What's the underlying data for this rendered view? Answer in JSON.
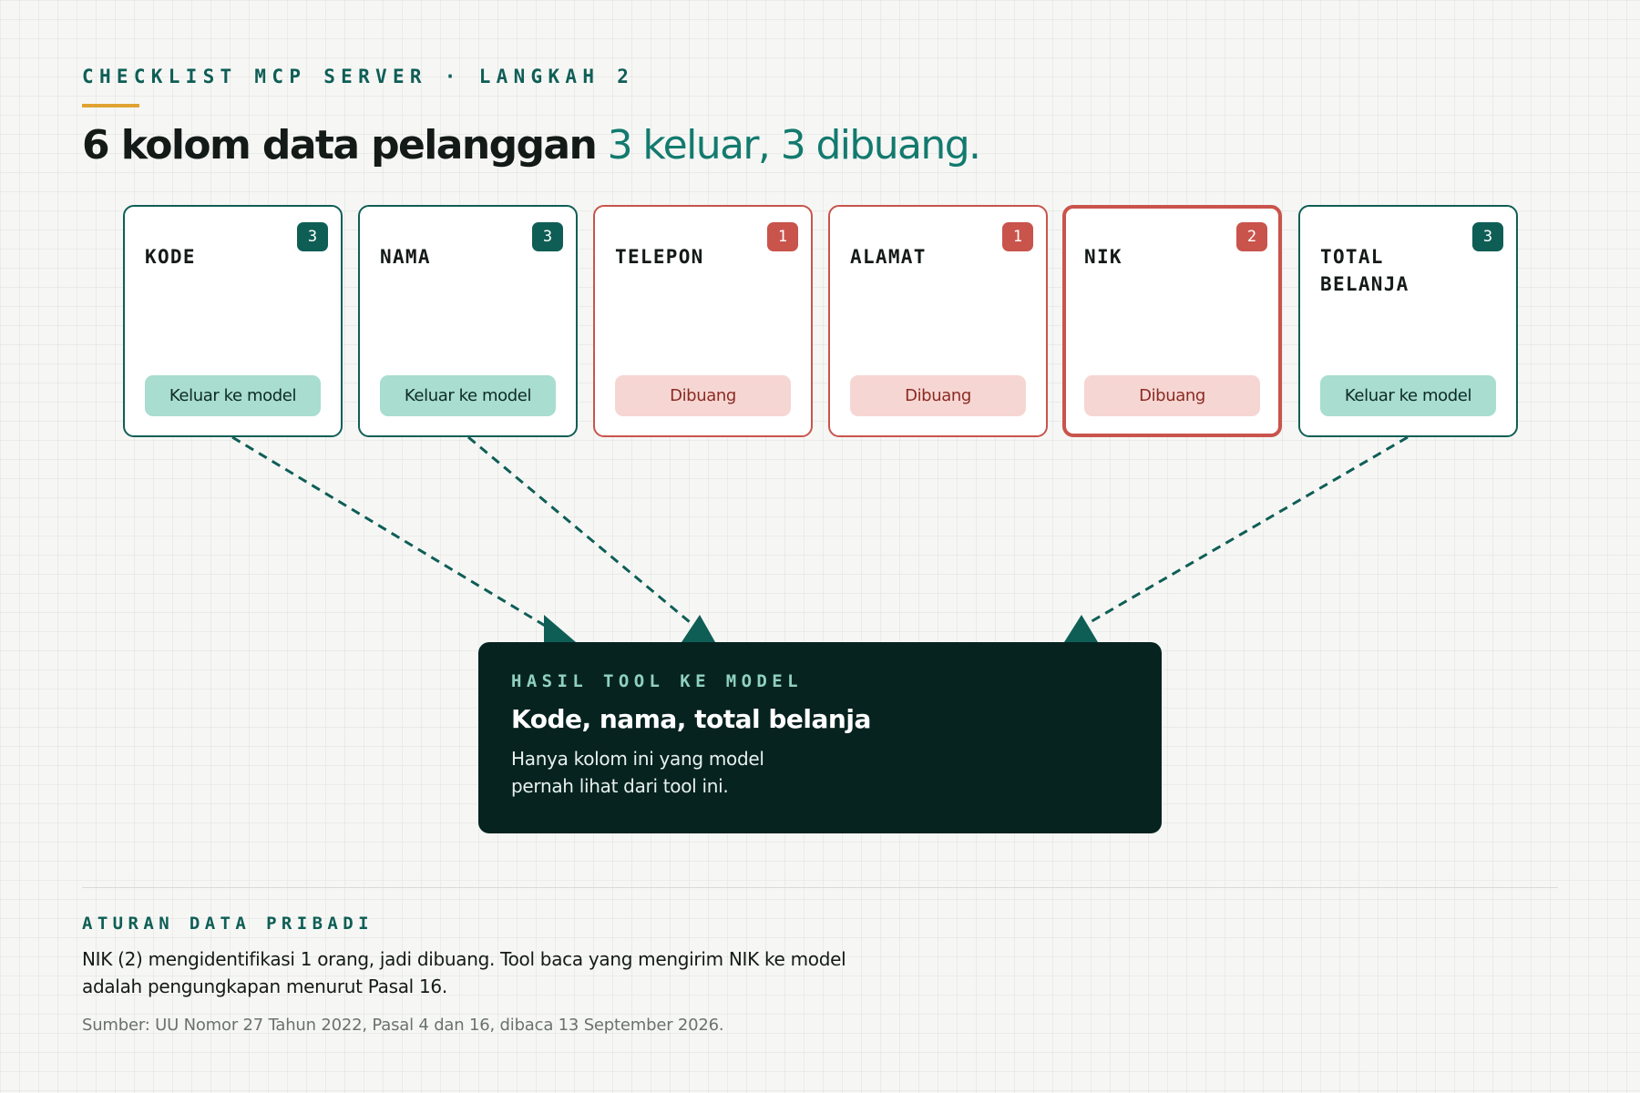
{
  "header": {
    "eyebrow": "CHECKLIST MCP SERVER · LANGKAH 2",
    "title_strong": "6 kolom data pelanggan",
    "title_accent": "3 keluar, 3 dibuang."
  },
  "columns": [
    {
      "name": "KODE",
      "badge": "3",
      "status": "Keluar ke model",
      "state": "keep"
    },
    {
      "name": "NAMA",
      "badge": "3",
      "status": "Keluar ke model",
      "state": "keep"
    },
    {
      "name": "TELEPON",
      "badge": "1",
      "status": "Dibuang",
      "state": "drop"
    },
    {
      "name": "ALAMAT",
      "badge": "1",
      "status": "Dibuang",
      "state": "drop"
    },
    {
      "name": "NIK",
      "badge": "2",
      "status": "Dibuang",
      "state": "drop-emphasis"
    },
    {
      "name": "TOTAL BELANJA",
      "badge": "3",
      "status": "Keluar ke model",
      "state": "keep"
    }
  ],
  "result": {
    "eyebrow": "HASIL TOOL KE MODEL",
    "title": "Kode, nama, total belanja",
    "body": "Hanya kolom ini yang model pernah lihat dari tool ini."
  },
  "rule": {
    "eyebrow": "ATURAN DATA PRIBADI",
    "body": "NIK (2) mengidentifikasi 1 orang, jadi dibuang. Tool baca yang mengirim NIK ke model adalah pengungkapan menurut Pasal 16.",
    "source": "Sumber: UU Nomor 27 Tahun 2022, Pasal 4 dan 16, dibaca 13 September 2026."
  },
  "colors": {
    "keep": "#0f5e56",
    "drop": "#c9544c",
    "accent_rule": "#e0a331",
    "result_bg": "#062320"
  }
}
